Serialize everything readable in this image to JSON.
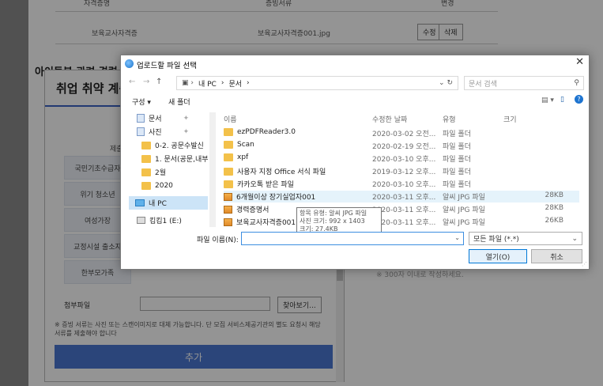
{
  "page": {
    "header_cols": [
      "자격증명",
      "증빙서류",
      "변경"
    ],
    "row1": {
      "cert": "보육교사자격증",
      "file": "보육교사자격증001.jpg",
      "edit": "수정",
      "delete": "삭제"
    },
    "section_title": "아이돌봄 관련 경력",
    "note_right": "※ 300자 이내로 작성하세요."
  },
  "modal": {
    "title": "취업 취약 계층",
    "submit_label": "제출",
    "categories": [
      "국민기초수급자",
      "위기 청소년",
      "여성가장",
      "교정시설 출소자",
      "한부모가족"
    ],
    "attach_label": "첨부파일",
    "browse_label": "찾아보기...",
    "notice": "※ 증빙 서류는 사진 또는 스캔이미지로 대체 가능합니다. 단 모집 서비스제공기관의 별도 요청시 해당 서류를 제출해야 합니다",
    "add_label": "추가"
  },
  "dialog": {
    "title": "업로드할 파일 선택",
    "close": "✕",
    "path": [
      "내 PC",
      "문서"
    ],
    "search_placeholder": "문서 검색",
    "toolbar": {
      "organize": "구성 ▾",
      "new_folder": "새 폴더"
    },
    "sidebar": [
      {
        "label": "문서",
        "icon": "doc"
      },
      {
        "label": "사진",
        "icon": "doc"
      },
      {
        "label": "0-2. 공문수발신",
        "icon": "folder"
      },
      {
        "label": "1. 문서(공문,내부",
        "icon": "folder"
      },
      {
        "label": "2월",
        "icon": "folder"
      },
      {
        "label": "2020",
        "icon": "folder"
      },
      {
        "label": "내 PC",
        "icon": "pc"
      },
      {
        "label": "킴킴1 (E:)",
        "icon": "drive"
      }
    ],
    "columns": {
      "name": "이름",
      "date": "수정한 날짜",
      "type": "유형",
      "size": "크기"
    },
    "files": [
      {
        "name": "ezPDFReader3.0",
        "date": "2020-03-02 오전...",
        "type": "파일 폴더",
        "size": "",
        "icon": "folder"
      },
      {
        "name": "Scan",
        "date": "2020-02-19 오전...",
        "type": "파일 폴더",
        "size": "",
        "icon": "folder"
      },
      {
        "name": "xpf",
        "date": "2020-03-10 오후...",
        "type": "파일 폴더",
        "size": "",
        "icon": "folder"
      },
      {
        "name": "사용자 지정 Office 서식 파일",
        "date": "2019-03-12 오후...",
        "type": "파일 폴더",
        "size": "",
        "icon": "folder"
      },
      {
        "name": "카카오톡 받은 파일",
        "date": "2020-03-10 오후...",
        "type": "파일 폴더",
        "size": "",
        "icon": "folder"
      },
      {
        "name": "6개월이상 장기실업자001",
        "date": "2020-03-11 오후...",
        "type": "알씨 JPG 파일",
        "size": "28KB",
        "icon": "image"
      },
      {
        "name": "경력증명서",
        "date": "2020-03-11 오후...",
        "type": "알씨 JPG 파일",
        "size": "28KB",
        "icon": "image"
      },
      {
        "name": "보육교사자격증001",
        "date": "2020-03-11 오후...",
        "type": "알씨 JPG 파일",
        "size": "26KB",
        "icon": "image"
      }
    ],
    "tooltip": [
      "항목 유형: 알씨 JPG 파일",
      "사진 크기: 992 x 1403",
      "크기: 27.4KB"
    ],
    "filename_label": "파일 이름(N):",
    "file_type": "모든 파일 (*.*)",
    "open_label": "열기(O)",
    "cancel_label": "취소"
  }
}
